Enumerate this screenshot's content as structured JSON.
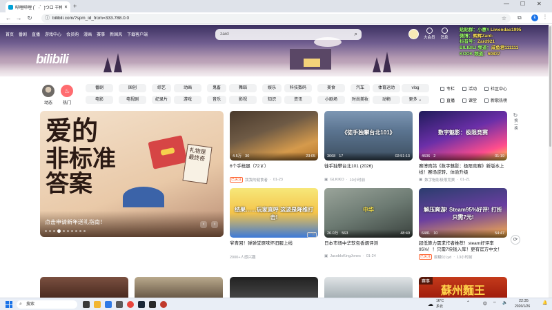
{
  "browser": {
    "tab_title": "哔哩哔哩 (゜-゜)つロ 干杯~-b...",
    "url": "bilibili.com/?spm_id_from=333.788.0.0",
    "nav": {
      "back": "←",
      "forward": "→",
      "reload": "↻"
    },
    "win_controls": {
      "min": "—",
      "max": "☐",
      "close": "✕"
    },
    "profile": "k"
  },
  "header": {
    "topnav": [
      "首页",
      "番剧",
      "直播",
      "游戏中心",
      "会员购",
      "漫画",
      "赛事",
      "新国风",
      "下载客户端"
    ],
    "logo": "bilibili",
    "search_value": "zard",
    "search_icon": "⌕",
    "rightnav": [
      {
        "label": "大会员",
        "icon": "vip-icon"
      },
      {
        "label": "消息",
        "icon": "message-icon"
      }
    ]
  },
  "overlay_text": {
    "lines": [
      {
        "prefix": "贴贴群：小惠Y ",
        "value": "Liwendao1995"
      },
      {
        "prefix": "微博：",
        "value": "辉辉Zard-"
      },
      {
        "prefix": "抖音号：",
        "value": "Zard921"
      },
      {
        "prefix": "BILIBILI 频道：",
        "value": "咸鱼君111111"
      },
      {
        "prefix": "KOOK 频道：",
        "value": "60837"
      }
    ]
  },
  "left_icons": [
    {
      "label": "动态",
      "color": "#8a8f96"
    },
    {
      "label": "热门",
      "color": "#ff6c70"
    }
  ],
  "categories_row1": [
    "番剧",
    "国创",
    "综艺",
    "动画",
    "鬼畜",
    "舞蹈",
    "娱乐",
    "科技数码",
    "美食",
    "汽车",
    "体育运动",
    "vlog"
  ],
  "categories_row2": [
    "电影",
    "电视剧",
    "纪录片",
    "游戏",
    "音乐",
    "影视",
    "知识",
    "资讯",
    "小剧场",
    "时尚美妆",
    "动物",
    "更多 ⌄"
  ],
  "right_links": {
    "row1": [
      "专栏",
      "活动",
      "社区中心"
    ],
    "row2": [
      "直播",
      "课堂",
      "新歌热榜"
    ]
  },
  "carousel": {
    "title": "点击申请新年送礼指南！",
    "big_text": [
      "爱的",
      "非标准",
      "答案"
    ],
    "sign_text": "礼物是最终奇",
    "prev": "‹",
    "next": "›",
    "dots": 10,
    "active_dot": 4
  },
  "float_buttons": [
    {
      "icon": "↻",
      "label": "换一换"
    },
    {
      "icon": "⟳",
      "label": ""
    }
  ],
  "videos": [
    {
      "title": "6个手枪腿（72￥）",
      "views": "4.5万",
      "comments": "30",
      "duration": "23:05",
      "tag": "已关注",
      "author": "我我的健食者",
      "date": "01-23",
      "bg": "linear-gradient(160deg,#4a3a2c 0%,#6e5a45 40%,#d59a4c 75%,#b5762c 100%)"
    },
    {
      "title": "徒手独攀台北101 (2026)",
      "views": "3068",
      "comments": "17",
      "duration": "02:51:13",
      "tag": "",
      "author": "GLKIKO",
      "date": "10小时前",
      "bg": "linear-gradient(180deg,#7d97b4 0%,#5b7490 40%,#3d4f60 100%)",
      "overlay": "《徒手独攀台北101》"
    },
    {
      "title": "赛博肉鸽《数字魅影：极限竞赛》新版本上线！赛场逆转，体验升级",
      "views": "4606",
      "comments": "2",
      "duration": "01:19",
      "tag": "",
      "author": "数字魅影极限竞赛",
      "date": "01-21",
      "bg": "linear-gradient(160deg,#1f1c5a 0%,#6b2fa8 45%,#ff4d8d 80%,#ffd54a 100%)",
      "overlay": "数字魅影：极限竞赛"
    },
    {
      "title": "爷青回！弹弹堂原味怀旧服上线",
      "views": "",
      "comments": "",
      "duration": "",
      "tag": "",
      "author": "2000+人感兴趣",
      "date": "",
      "ad": "广告",
      "bg": "linear-gradient(180deg,#f7e87a 0%,#f4c34a 50%,#3c7ad9 100%)",
      "overlay": "结果……玩家直呼 这波是降维打击!"
    },
    {
      "title": "日本市场中华软包香烟评测",
      "views": "26.0万",
      "comments": "563",
      "duration": "48:49",
      "tag": "",
      "author": "JacobIsKingJones",
      "date": "01-24",
      "bg": "linear-gradient(160deg,#9aa49a 0%,#6c7a72 50%,#3a423e 100%)",
      "overlay": "中华"
    },
    {
      "title": "超低算力需求作者推荐！steam好评率95%！！只需7块钱入库！更有官方中文！《冥...",
      "views": "6481",
      "comments": "10",
      "duration": "54:47",
      "tag": "已关注",
      "author": "废糖公Lyd",
      "date": "13小时前",
      "bg": "linear-gradient(170deg,#2b3d6e 0%,#6a3fa0 50%,#ffb347 100%)",
      "overlay": "解压爽游! Steam95%好评! 打折只需7元!"
    }
  ],
  "bottom_thumbs": [
    {
      "bg": "linear-gradient(180deg,#7a5040,#4a2a20)",
      "text": ""
    },
    {
      "bg": "linear-gradient(180deg,#b9a98c,#6a5a48)",
      "text": ""
    },
    {
      "bg": "linear-gradient(180deg,#222,#444)",
      "text": ""
    },
    {
      "bg": "linear-gradient(180deg,#e0e4e6,#a7b1b6)",
      "text": ""
    },
    {
      "bg": "linear-gradient(180deg,#c43b1b,#a01d0c)",
      "text": "蘇州麵王"
    },
    {
      "bg": "linear-gradient(180deg,#d9d9d9,#9a9a9a)",
      "text": ""
    }
  ],
  "bottom_badge": "赛事",
  "taskbar": {
    "search_placeholder": "搜索",
    "weather_temp": "16°C",
    "weather_desc": "多云",
    "ime": "中",
    "time": "22:35",
    "date": "2026/1/26"
  }
}
